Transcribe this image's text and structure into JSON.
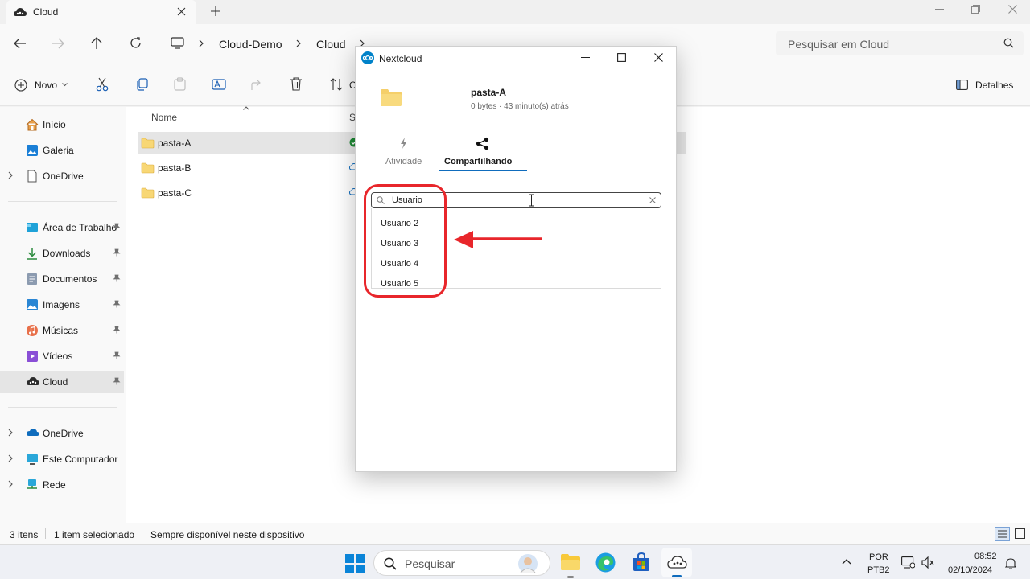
{
  "explorer": {
    "tab_title": "Cloud",
    "breadcrumb": [
      "Cloud-Demo",
      "Cloud"
    ],
    "search_placeholder": "Pesquisar em Cloud",
    "toolbar": {
      "new_label": "Novo",
      "sort_label": "O",
      "details_label": "Detalhes"
    },
    "columns": {
      "name": "Nome",
      "status": "S"
    },
    "nav": {
      "top": [
        {
          "label": "Início",
          "icon": "home-icon"
        },
        {
          "label": "Galeria",
          "icon": "gallery-icon"
        },
        {
          "label": "OneDrive",
          "icon": "document-icon"
        }
      ],
      "quick": [
        {
          "label": "Área de Trabalho",
          "icon": "desktop-icon"
        },
        {
          "label": "Downloads",
          "icon": "download-icon"
        },
        {
          "label": "Documentos",
          "icon": "documents-icon"
        },
        {
          "label": "Imagens",
          "icon": "pictures-icon"
        },
        {
          "label": "Músicas",
          "icon": "music-icon"
        },
        {
          "label": "Vídeos",
          "icon": "videos-icon"
        },
        {
          "label": "Cloud",
          "icon": "cloud-app-icon"
        }
      ],
      "bottom": [
        {
          "label": "OneDrive",
          "icon": "onedrive-icon"
        },
        {
          "label": "Este Computador",
          "icon": "computer-icon"
        },
        {
          "label": "Rede",
          "icon": "network-icon"
        }
      ]
    },
    "files": [
      {
        "name": "pasta-A",
        "selected": true
      },
      {
        "name": "pasta-B",
        "selected": false
      },
      {
        "name": "pasta-C",
        "selected": false
      }
    ],
    "status": {
      "count": "3 itens",
      "selected": "1 item selecionado",
      "availability": "Sempre disponível neste dispositivo"
    }
  },
  "dialog": {
    "title": "Nextcloud",
    "folder_name": "pasta-A",
    "folder_meta": "0 bytes · 43 minuto(s) atrás",
    "tabs": {
      "activity": "Atividade",
      "sharing": "Compartilhando"
    },
    "share_input_value": "Usuario",
    "suggestions": [
      "Usuario 2",
      "Usuario 3",
      "Usuario 4",
      "Usuario 5"
    ]
  },
  "taskbar": {
    "search_label": "Pesquisar",
    "language": "POR",
    "layout": "PTB2",
    "time": "08:52",
    "date": "02/10/2024"
  },
  "colors": {
    "accent": "#0f6cbd",
    "nextcloud_blue": "#0082c9",
    "annotation_red": "#e8262b",
    "folder_yellow": "#f8d775"
  }
}
